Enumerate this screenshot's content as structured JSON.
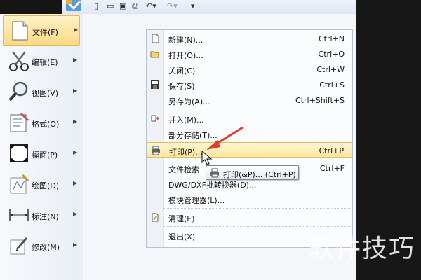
{
  "categories": [
    {
      "label": "文件(F)",
      "icon": "file-icon",
      "active": true
    },
    {
      "label": "编辑(E)",
      "icon": "scissors-icon"
    },
    {
      "label": "视图(V)",
      "icon": "magnifier-icon"
    },
    {
      "label": "格式(O)",
      "icon": "format-icon"
    },
    {
      "label": "幅面(P)",
      "icon": "frame-icon"
    },
    {
      "label": "绘图(D)",
      "icon": "draw-icon"
    },
    {
      "label": "标注(N)",
      "icon": "dimension-icon"
    },
    {
      "label": "修改(M)",
      "icon": "modify-icon"
    }
  ],
  "file_menu": [
    {
      "label": "新建(N)...",
      "shortcut": "Ctrl+N",
      "icon": "new-doc-icon"
    },
    {
      "label": "打开(O)...",
      "shortcut": "Ctrl+O",
      "icon": "open-folder-icon"
    },
    {
      "label": "关闭(C)",
      "shortcut": "Ctrl+W",
      "icon": ""
    },
    {
      "label": "保存(S)",
      "shortcut": "Ctrl+S",
      "icon": "save-icon"
    },
    {
      "label": "另存为(A)...",
      "shortcut": "Ctrl+Shift+S",
      "icon": ""
    },
    {
      "label": "并入(M)...",
      "shortcut": "",
      "icon": "merge-icon"
    },
    {
      "label": "部分存储(T)...",
      "shortcut": "",
      "icon": ""
    },
    {
      "label": "打印(P)...",
      "shortcut": "Ctrl+P",
      "icon": "printer-icon"
    },
    {
      "label": "文件检索",
      "shortcut": "Ctrl+F",
      "icon": ""
    },
    {
      "label": "DWG/DXF批转换器(D)...",
      "shortcut": "",
      "icon": ""
    },
    {
      "label": "模块管理器(L)...",
      "shortcut": "",
      "icon": ""
    },
    {
      "label": "清理(E)",
      "shortcut": "",
      "icon": "purge-icon"
    },
    {
      "label": "退出(X)",
      "shortcut": "",
      "icon": ""
    }
  ],
  "tooltip": {
    "label": "打印(&P)... (Ctrl+P)"
  },
  "watermark": "软件技巧"
}
